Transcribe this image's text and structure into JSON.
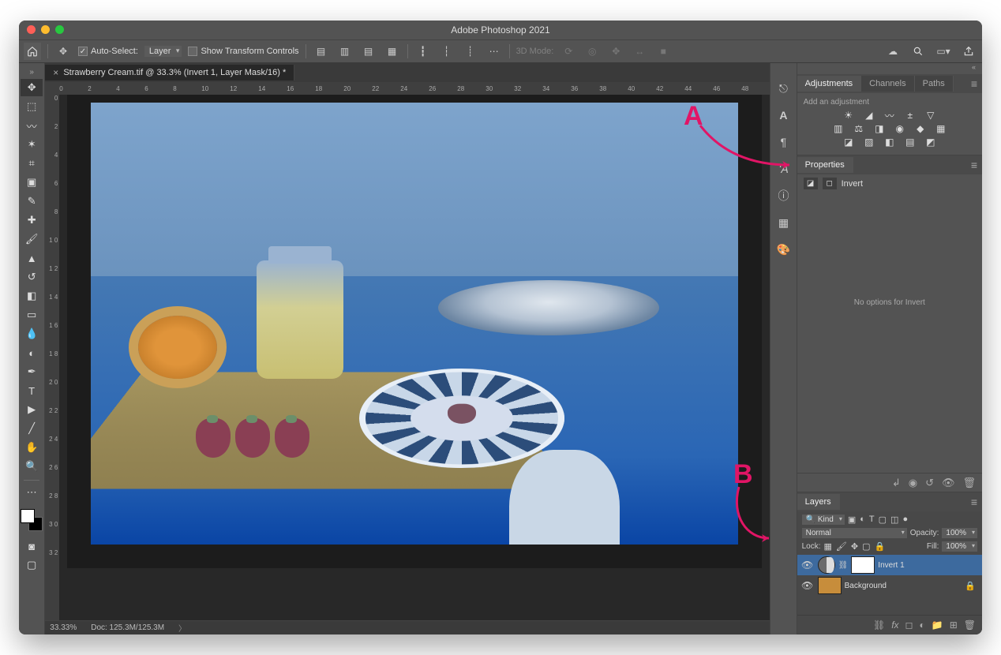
{
  "app": {
    "title": "Adobe Photoshop 2021"
  },
  "options_bar": {
    "auto_select_label": "Auto-Select:",
    "auto_select_checked": true,
    "target": "Layer",
    "show_transform_label": "Show Transform Controls",
    "show_transform_checked": false,
    "mode_3d_label": "3D Mode:"
  },
  "document": {
    "tab_title": "Strawberry Cream.tif @ 33.3% (Invert 1, Layer Mask/16) *",
    "zoom": "33.33%",
    "doc_info": "Doc: 125.3M/125.3M"
  },
  "ruler_h": [
    "0",
    "2",
    "4",
    "6",
    "8",
    "10",
    "12",
    "14",
    "16",
    "18",
    "20",
    "22",
    "24",
    "26",
    "28",
    "30",
    "32",
    "34",
    "36",
    "38",
    "40",
    "42",
    "44",
    "46",
    "48"
  ],
  "ruler_v": [
    "0",
    "2",
    "4",
    "6",
    "8",
    "1 0",
    "1 2",
    "1 4",
    "1 6",
    "1 8",
    "2 0",
    "2 2",
    "2 4",
    "2 6",
    "2 8",
    "3 0",
    "3 2"
  ],
  "panels": {
    "adjustments": {
      "tab": "Adjustments",
      "other_tabs": [
        "Channels",
        "Paths"
      ],
      "hint": "Add an adjustment"
    },
    "properties": {
      "tab": "Properties",
      "adjustment_name": "Invert",
      "message": "No options for Invert"
    },
    "layers": {
      "tab": "Layers",
      "filter_label": "Kind",
      "blend_mode": "Normal",
      "opacity_label": "Opacity:",
      "opacity_value": "100%",
      "lock_label": "Lock:",
      "fill_label": "Fill:",
      "fill_value": "100%",
      "items": [
        {
          "name": "Invert 1",
          "type": "adjustment",
          "visible": true,
          "active": true,
          "locked": false
        },
        {
          "name": "Background",
          "type": "image",
          "visible": true,
          "active": false,
          "locked": true
        }
      ]
    }
  },
  "annotations": {
    "A": "A",
    "B": "B"
  }
}
